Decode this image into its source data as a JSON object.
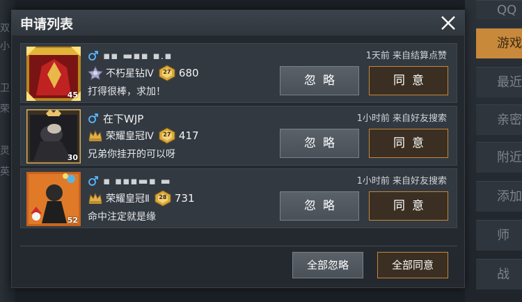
{
  "colors": {
    "accent": "#c8873a",
    "dialog_bg": "#24292f",
    "row_bg": "#333941",
    "gender_male": "#58b8ff"
  },
  "background": {
    "right_tabs": [
      "QQ",
      "游戏",
      "最近",
      "亲密",
      "附近",
      "添加",
      "师",
      "战"
    ],
    "left_glyphs": [
      "双",
      "小",
      "卫",
      "荣",
      "灵",
      "英"
    ]
  },
  "dialog": {
    "title": "申请列表",
    "close_icon": "close-icon",
    "requests": [
      {
        "avatar_icon": "avatar-gold-frame",
        "avatar_level": "45",
        "gender_icon": "male-icon",
        "name": "▪▪ ▬▪▪ ▪.▪",
        "rank_icon": "platinum-star-rank-icon",
        "rank_name": "不朽星钻Ⅳ",
        "rank_badge": "27",
        "rank_points": "680",
        "message": "打得很棒，求加！",
        "meta": "1天前  来自结算点赞",
        "ignore_label": "忽略",
        "agree_label": "同意"
      },
      {
        "avatar_icon": "avatar-crown-frame",
        "avatar_level": "30",
        "gender_icon": "male-icon",
        "name": "在下WJP",
        "rank_icon": "crown-rank-icon",
        "rank_name": "荣耀皇冠Ⅳ",
        "rank_badge": "27",
        "rank_points": "417",
        "message": "兄弟你挂开的可以呀",
        "meta": "1小时前  来自好友搜索",
        "ignore_label": "忽略",
        "agree_label": "同意"
      },
      {
        "avatar_icon": "avatar-orange-frame",
        "avatar_level": "52",
        "gender_icon": "male-icon",
        "name": "▪ ▪▪▪▬▪ ▬",
        "rank_icon": "crown-rank-icon",
        "rank_name": "荣耀皇冠Ⅱ",
        "rank_badge": "28",
        "rank_points": "731",
        "message": "命中注定就是缘",
        "meta": "1小时前  来自好友搜索",
        "ignore_label": "忽略",
        "agree_label": "同意"
      }
    ],
    "footer": {
      "ignore_all_label": "全部忽略",
      "agree_all_label": "全部同意"
    }
  }
}
